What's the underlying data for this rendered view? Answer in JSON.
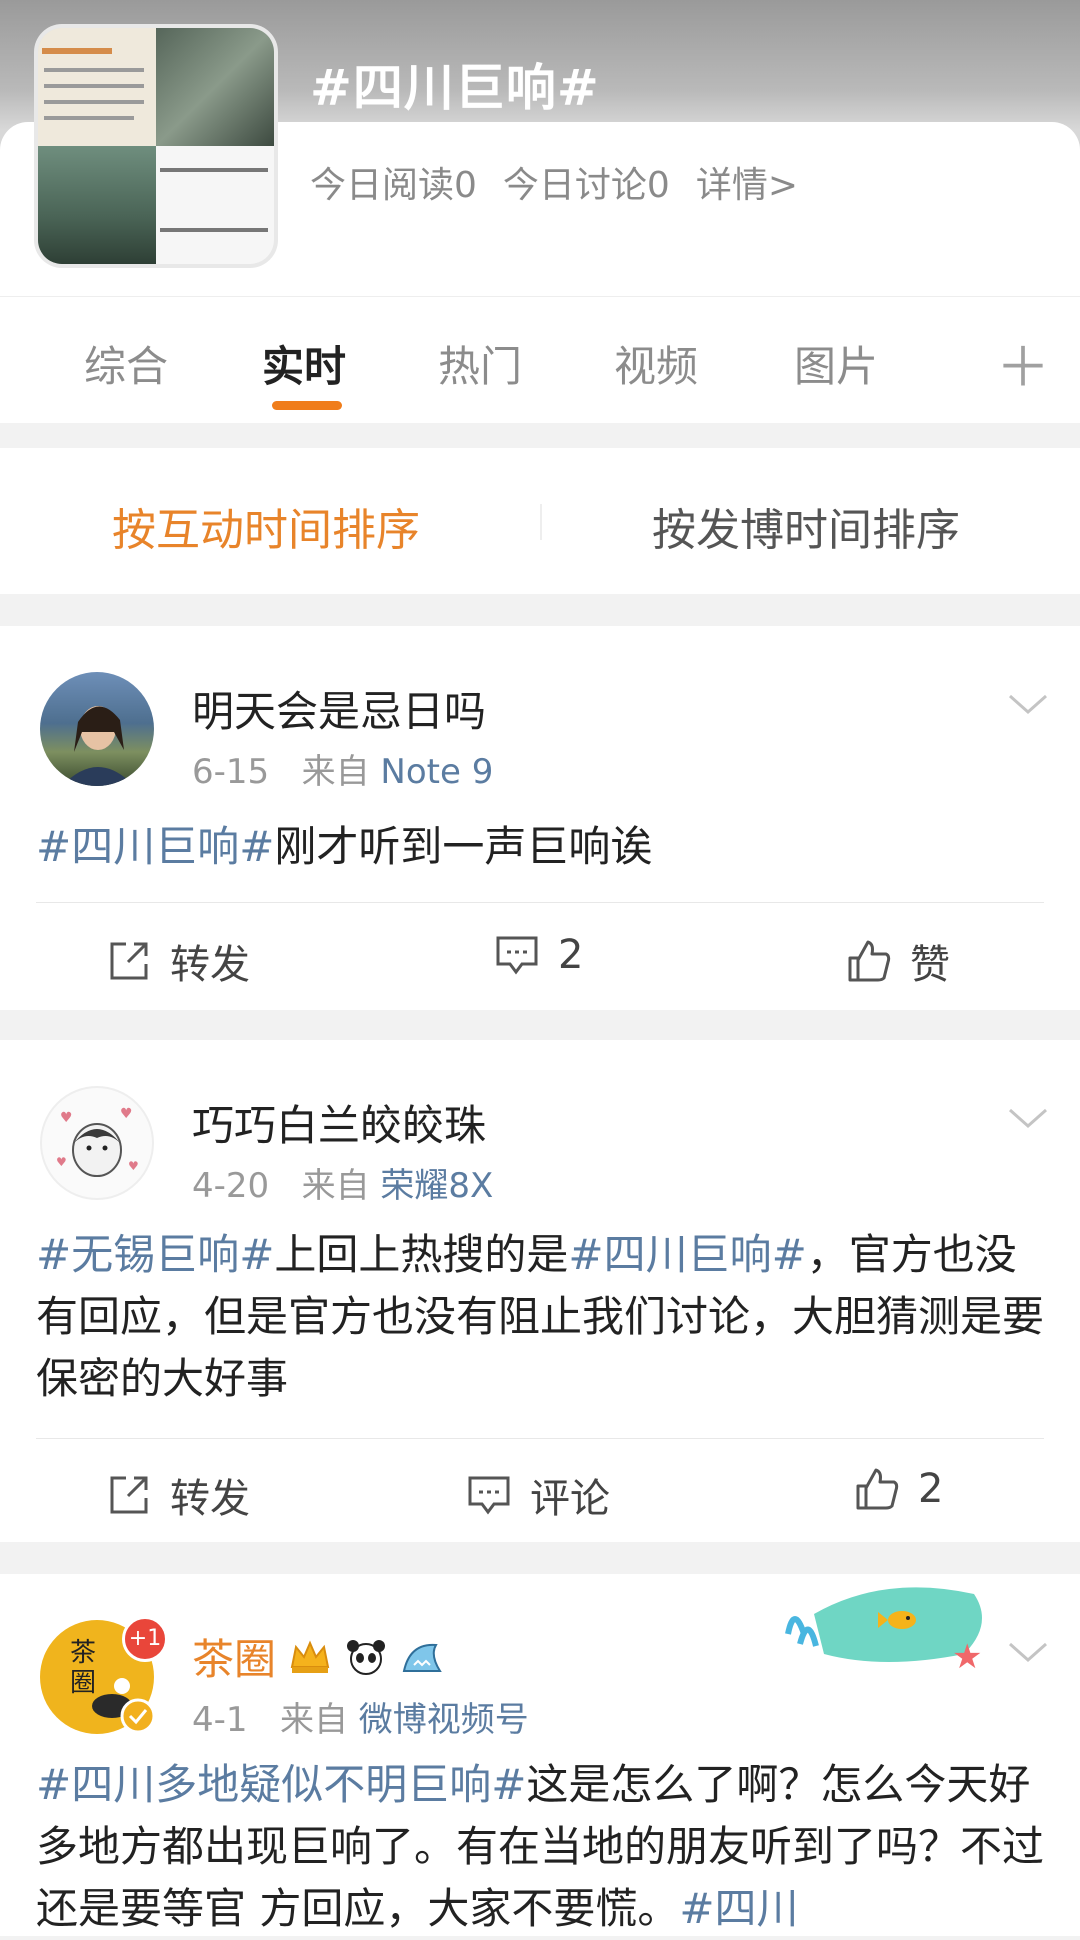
{
  "header": {
    "topic_title": "#四川巨响#",
    "stats": {
      "read": "今日阅读0",
      "discuss": "今日讨论0",
      "detail": "详情>"
    }
  },
  "tabs": {
    "items": [
      "综合",
      "实时",
      "热门",
      "视频",
      "图片"
    ],
    "active": "实时"
  },
  "sort": {
    "by_interaction": "按互动时间排序",
    "by_post": "按发博时间排序"
  },
  "posts": [
    {
      "username": "明天会是忌日吗",
      "date": "6-15",
      "from": "来自",
      "source": "Note 9",
      "content": {
        "tag": "#四川巨响#",
        "text": "刚才听到一声巨响诶"
      },
      "actions": {
        "repost": "转发",
        "comment": "2",
        "like": "赞"
      }
    },
    {
      "username": "巧巧白兰皎皎珠",
      "date": "4-20",
      "from": "来自",
      "source": "荣耀8X",
      "content": {
        "tag1": "#无锡巨响#",
        "text1": "上回上热搜的是",
        "tag2": "#四川巨响#",
        "text2": "，官方也没有回应，但是官方也没有阻止我们讨论，大胆猜测是要保密的大好事"
      },
      "actions": {
        "repost": "转发",
        "comment": "评论",
        "like": "2"
      }
    },
    {
      "username": "茶圈",
      "avatar_text": "茶圈",
      "notification": "+1",
      "date": "4-1",
      "from": "来自",
      "source": "微博视频号",
      "content": {
        "tag1": "#四川多地疑似不明巨响#",
        "text1": "这是怎么了啊？怎么今天好多地方都出现巨响了。有在当地的朋友听到了吗？不过还是要等官 方回应，大家不要慌。",
        "tag2": "#四川"
      }
    }
  ],
  "colors": {
    "accent": "#e8842a",
    "link": "#5b7ca1"
  }
}
